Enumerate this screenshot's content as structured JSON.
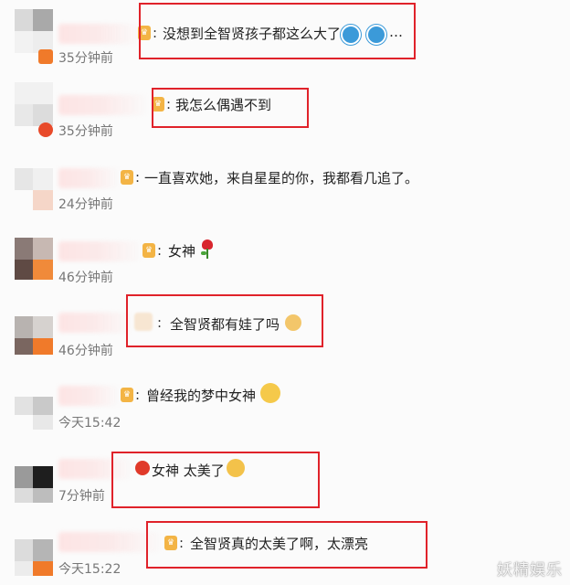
{
  "comments": [
    {
      "text": "没想到全智贤孩子都这么大了",
      "trailing": "…",
      "time": "35分钟前",
      "emojis": [
        "doraemon-icon",
        "doraemon-icon"
      ]
    },
    {
      "text": "我怎么偶遇不到",
      "time": "35分钟前"
    },
    {
      "text": "一直喜欢她，来自星星的你，我都看几追了。",
      "time": "24分钟前"
    },
    {
      "text": "女神",
      "time": "46分钟前",
      "emojis": [
        "rose-icon"
      ]
    },
    {
      "text": "全智贤都有娃了吗",
      "time": "46分钟前",
      "emojis": [
        "doge-icon"
      ]
    },
    {
      "text": "曾经我的梦中女神",
      "time": "今天15:42",
      "emojis": [
        "drooling-face-icon"
      ]
    },
    {
      "text": "女神 太美了",
      "time": "7分钟前",
      "emojis": [
        "crying-face-icon"
      ]
    },
    {
      "text": "全智贤真的太美了啊，太漂亮",
      "time": "今天15:22"
    }
  ],
  "colon": ":",
  "badge": "♛",
  "watermark": "妖精娱乐",
  "colors": {
    "highlight": "#e0222a",
    "timestamp": "#777777",
    "badge": "#f3b445"
  }
}
